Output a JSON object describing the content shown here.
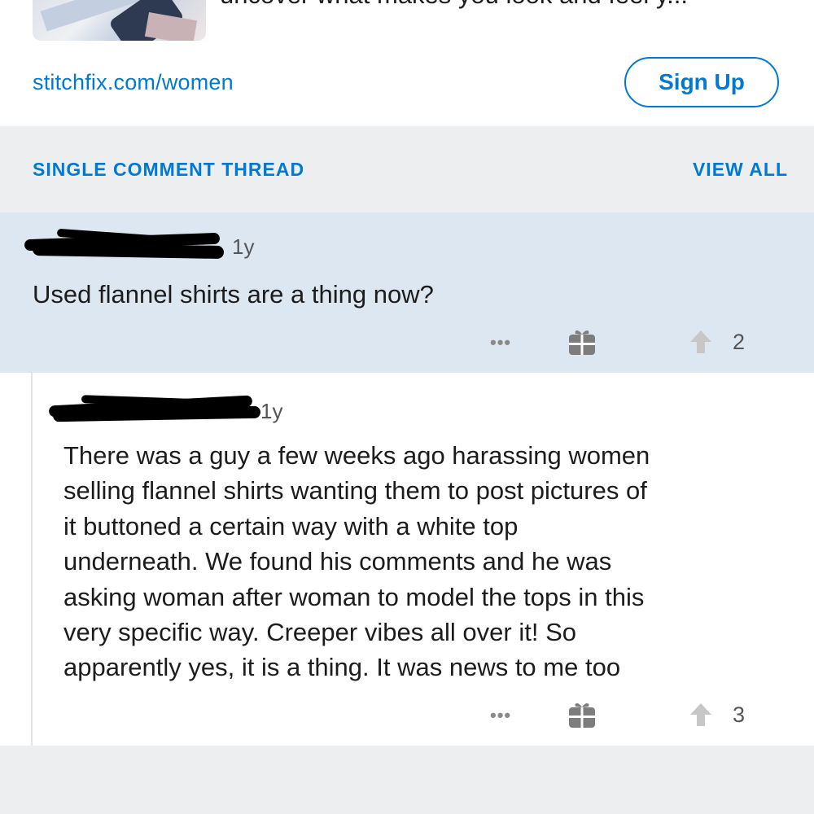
{
  "ad": {
    "teaser_text": "uncover what makes you look and feel y...",
    "link_text": "stitchfix.com/women",
    "signup_label": "Sign Up"
  },
  "thread": {
    "title": "SINGLE COMMENT THREAD",
    "view_all_label": "VIEW ALL"
  },
  "comments": [
    {
      "age": "1y",
      "body": "Used flannel shirts are a thing now?",
      "more_label": "•••",
      "upvotes": "2"
    },
    {
      "age": "1y",
      "body_lines": [
        "There was a guy a few weeks ago harassing women",
        "selling flannel shirts wanting them to post pictures of",
        "it buttoned a certain way with a white top",
        "underneath. We found his comments and he was",
        "asking woman after woman to model the tops in this",
        "very specific way. Creeper vibes all over it! So",
        "apparently yes, it is a thing. It was news to me too"
      ],
      "more_label": "•••",
      "upvotes": "3"
    }
  ],
  "icons": {
    "gift": "gift-icon",
    "upvote": "upvote-arrow-icon",
    "more": "more-options-icon"
  },
  "colors": {
    "accent": "#0079d3",
    "highlight_bg": "#dde7f2",
    "section_bg": "#edeef0"
  }
}
